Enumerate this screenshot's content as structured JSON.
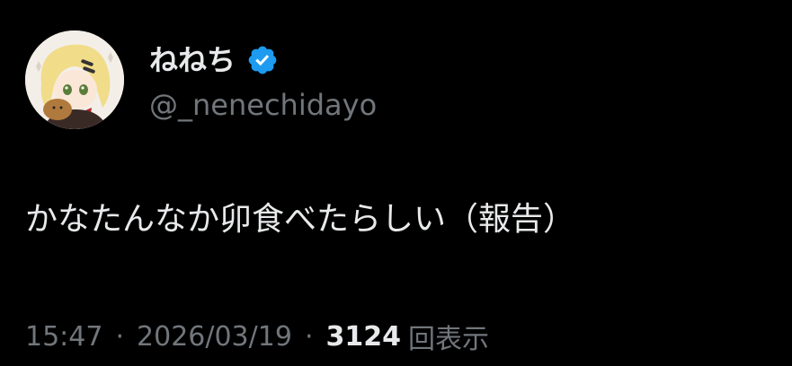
{
  "tweet": {
    "author": {
      "display_name": "ねねち",
      "handle": "@_nenechidayo",
      "verified": true,
      "avatar_icon": "profile-avatar-anime-girl"
    },
    "text": "かなたんなか卯食べたらしい（報告）",
    "meta": {
      "time": "15:47",
      "separator": "·",
      "date": "2026/03/19",
      "views_count": "3124",
      "views_label": "回表示"
    }
  },
  "colors": {
    "background": "#000000",
    "primary_text": "#e7e9ea",
    "secondary_text": "#71767b",
    "verified_badge": "#1d9bf0"
  }
}
